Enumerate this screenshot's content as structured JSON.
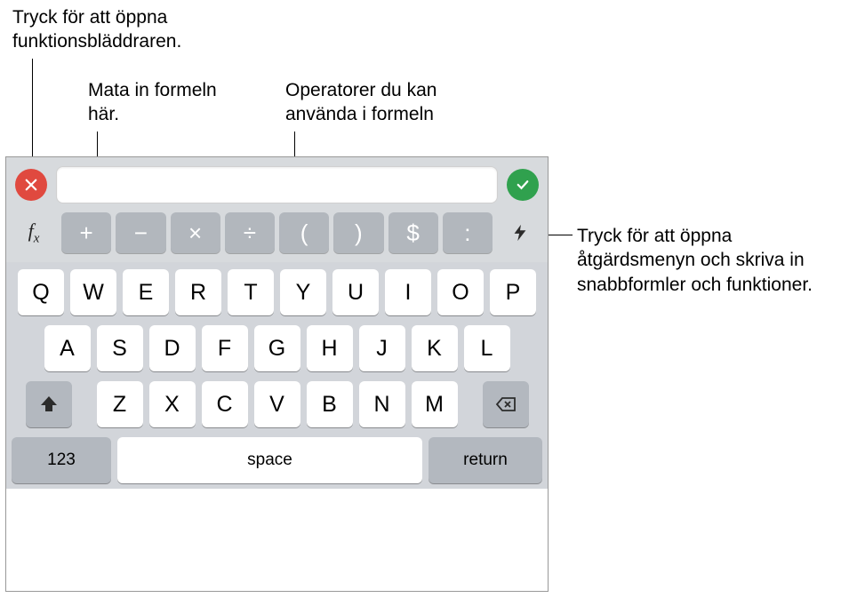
{
  "callouts": {
    "fx": "Tryck för att öppna funktionsbläddraren.",
    "formula": "Mata in formeln här.",
    "operators": "Operatorer du kan använda i formeln",
    "bolt": "Tryck för att öppna åtgärdsmenyn och skriva in snabbformler och funktioner."
  },
  "formula": {
    "value": "",
    "placeholder": ""
  },
  "fx_label": "f",
  "fx_sub": "x",
  "operators": [
    "+",
    "−",
    "×",
    "÷",
    "(",
    ")",
    "$",
    ":"
  ],
  "keyboard": {
    "row1": [
      "Q",
      "W",
      "E",
      "R",
      "T",
      "Y",
      "U",
      "I",
      "O",
      "P"
    ],
    "row2": [
      "A",
      "S",
      "D",
      "F",
      "G",
      "H",
      "J",
      "K",
      "L"
    ],
    "row3": [
      "Z",
      "X",
      "C",
      "V",
      "B",
      "N",
      "M"
    ],
    "k123": "123",
    "space": "space",
    "return": "return"
  }
}
